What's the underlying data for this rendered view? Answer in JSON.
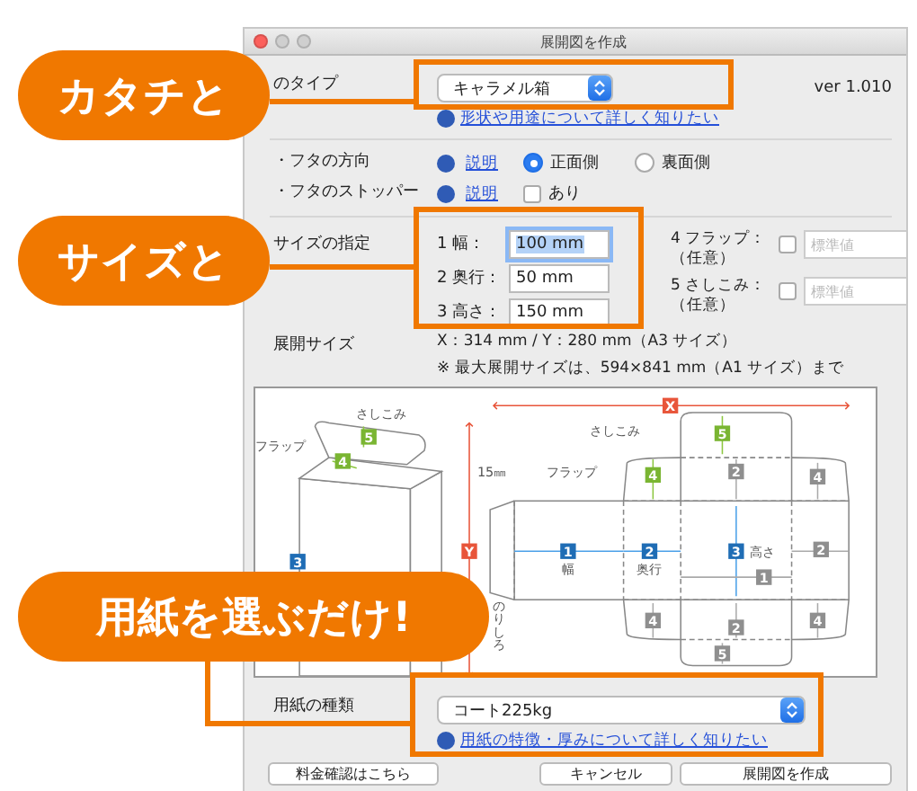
{
  "window": {
    "title": "展開図を作成",
    "version": "ver 1.010"
  },
  "box_type": {
    "label": "のタイプ",
    "value": "キャラメル箱",
    "link": "形状や用途について詳しく知りたい"
  },
  "lid_direction": {
    "label": "・フタの方向",
    "help": "説明",
    "options": [
      {
        "label": "正面側",
        "selected": true
      },
      {
        "label": "裏面側",
        "selected": false
      }
    ]
  },
  "lid_stopper": {
    "label": "・フタのストッパー",
    "help": "説明",
    "checkbox": {
      "label": "あり",
      "checked": false
    }
  },
  "size": {
    "label": "サイズの指定",
    "fields": [
      {
        "label": "1 幅：",
        "value": "100 mm",
        "focused": true
      },
      {
        "label": "2 奥行：",
        "value": "50 mm",
        "focused": false
      },
      {
        "label": "3 高さ：",
        "value": "150 mm",
        "focused": false
      }
    ],
    "optional": [
      {
        "label": "4 フラップ：",
        "note": "（任意）",
        "checked": false,
        "placeholder": "標準値"
      },
      {
        "label": "5 さしこみ：",
        "note": "（任意）",
        "checked": false,
        "placeholder": "標準値"
      }
    ]
  },
  "sheet_size": {
    "label": "展開サイズ",
    "value": "X：314 mm / Y：280 mm（A3 サイズ）",
    "note": "※ 最大展開サイズは、594×841 mm（A1 サイズ）まで"
  },
  "diagram": {
    "labels": [
      {
        "kind": "caption",
        "text": "さしこみ"
      },
      {
        "kind": "caption",
        "text": "フラップ"
      },
      {
        "kind": "green",
        "text": "5"
      },
      {
        "kind": "green",
        "text": "4"
      },
      {
        "kind": "blue",
        "text": "3"
      },
      {
        "kind": "red",
        "text": "X"
      },
      {
        "kind": "red",
        "text": "Y"
      },
      {
        "kind": "caption",
        "text": "さしこみ"
      },
      {
        "kind": "caption",
        "text": "15㎜"
      },
      {
        "kind": "caption",
        "text": "フラップ"
      },
      {
        "kind": "vertical",
        "text": "のりしろ"
      },
      {
        "kind": "green",
        "text": "5"
      },
      {
        "kind": "green",
        "text": "4"
      },
      {
        "kind": "blue",
        "text": "1"
      },
      {
        "kind": "caption",
        "text": "幅"
      },
      {
        "kind": "blue",
        "text": "2"
      },
      {
        "kind": "caption",
        "text": "奥行"
      },
      {
        "kind": "blue",
        "text": "3"
      },
      {
        "kind": "caption",
        "text": "高さ"
      },
      {
        "kind": "grey",
        "text": "2"
      },
      {
        "kind": "grey",
        "text": "4"
      },
      {
        "kind": "grey",
        "text": "2"
      },
      {
        "kind": "grey",
        "text": "1"
      },
      {
        "kind": "grey",
        "text": "4"
      },
      {
        "kind": "grey",
        "text": "2"
      },
      {
        "kind": "grey",
        "text": "4"
      },
      {
        "kind": "grey",
        "text": "5"
      }
    ]
  },
  "paper": {
    "label": "用紙の種類",
    "value": "コート225kg",
    "link": "用紙の特徴・厚みについて詳しく知りたい"
  },
  "buttons": [
    "料金確認はこちら",
    "キャンセル",
    "展開図を作成"
  ],
  "callouts": [
    "カタチと",
    "サイズと",
    "用紙を選ぶだけ!"
  ]
}
